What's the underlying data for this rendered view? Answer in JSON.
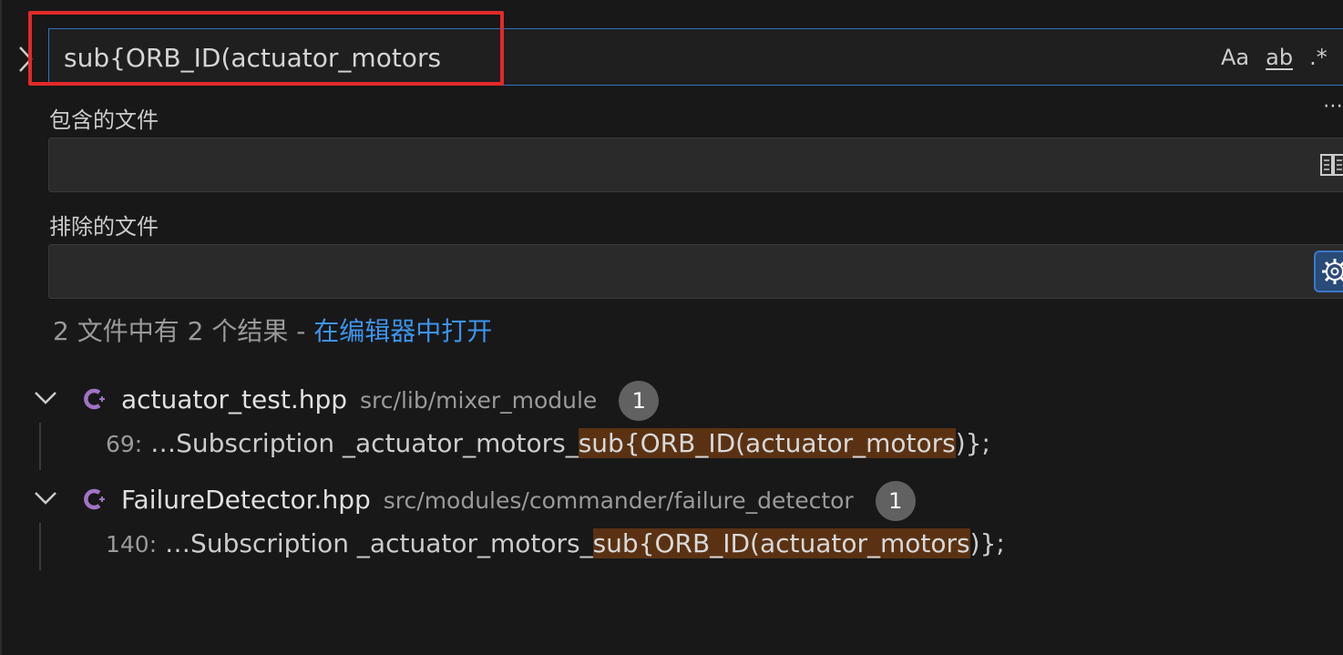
{
  "search": {
    "value": "sub{ORB_ID(actuator_motors",
    "match_case_label": "Aa",
    "whole_word_label": "ab",
    "regex_label": ".*"
  },
  "more_label": "⋯",
  "include": {
    "label": "包含的文件",
    "value": ""
  },
  "exclude": {
    "label": "排除的文件",
    "value": ""
  },
  "summary": {
    "text": "2 文件中有 2 个结果 - ",
    "open_in_editor": "在编辑器中打开"
  },
  "results": [
    {
      "file_name": "actuator_test.hpp",
      "path": "src/lib/mixer_module",
      "count": "1",
      "match": {
        "line": "69:",
        "before": "…Subscription _actuator_motors_",
        "highlight": "sub{ORB_ID(actuator_motors",
        "after": ")};"
      }
    },
    {
      "file_name": "FailureDetector.hpp",
      "path": "src/modules/commander/failure_detector",
      "count": "1",
      "match": {
        "line": "140:",
        "before": "…Subscription _actuator_motors_",
        "highlight": "sub{ORB_ID(actuator_motors",
        "after": ")};"
      }
    }
  ],
  "colors": {
    "background": "#181818",
    "accent": "#2f73c2",
    "link": "#3d94ec",
    "highlight_border": "#e02a2a",
    "match_bg": "#5a3213",
    "cpp_icon": "#a074c4"
  }
}
